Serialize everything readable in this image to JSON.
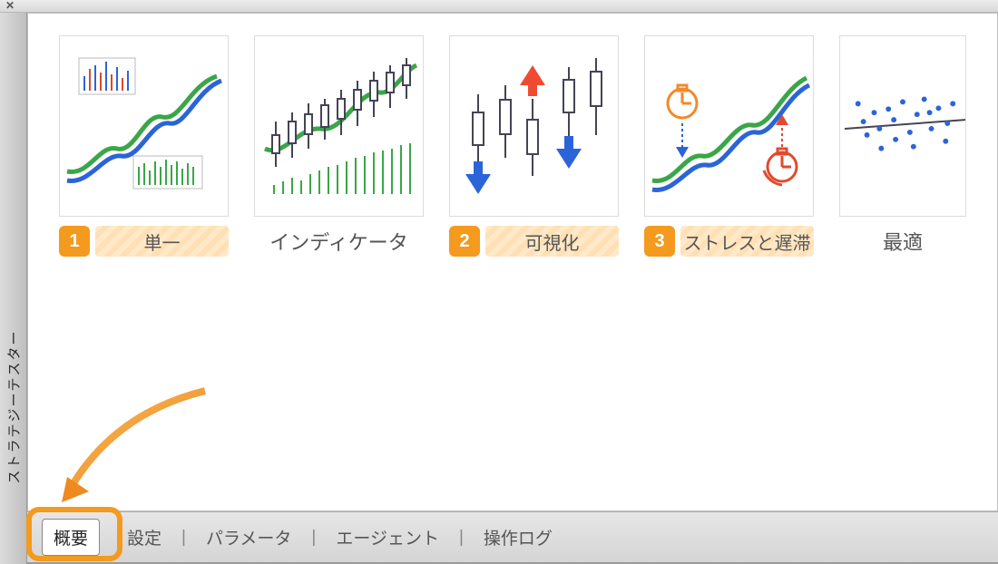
{
  "toolbar": {
    "close_label": "✕"
  },
  "side_tab": {
    "label": "ストラテジーテスター"
  },
  "cards": [
    {
      "badge": "1",
      "label": "単一"
    },
    {
      "badge": "",
      "label": "インディケータ"
    },
    {
      "badge": "2",
      "label": "可視化"
    },
    {
      "badge": "3",
      "label": "ストレスと遅滞"
    },
    {
      "badge": "",
      "label": "最適"
    }
  ],
  "bottom_tabs": {
    "overview": "概要",
    "settings": "設定",
    "parameters": "パラメータ",
    "agents": "エージェント",
    "log": "操作ログ"
  }
}
